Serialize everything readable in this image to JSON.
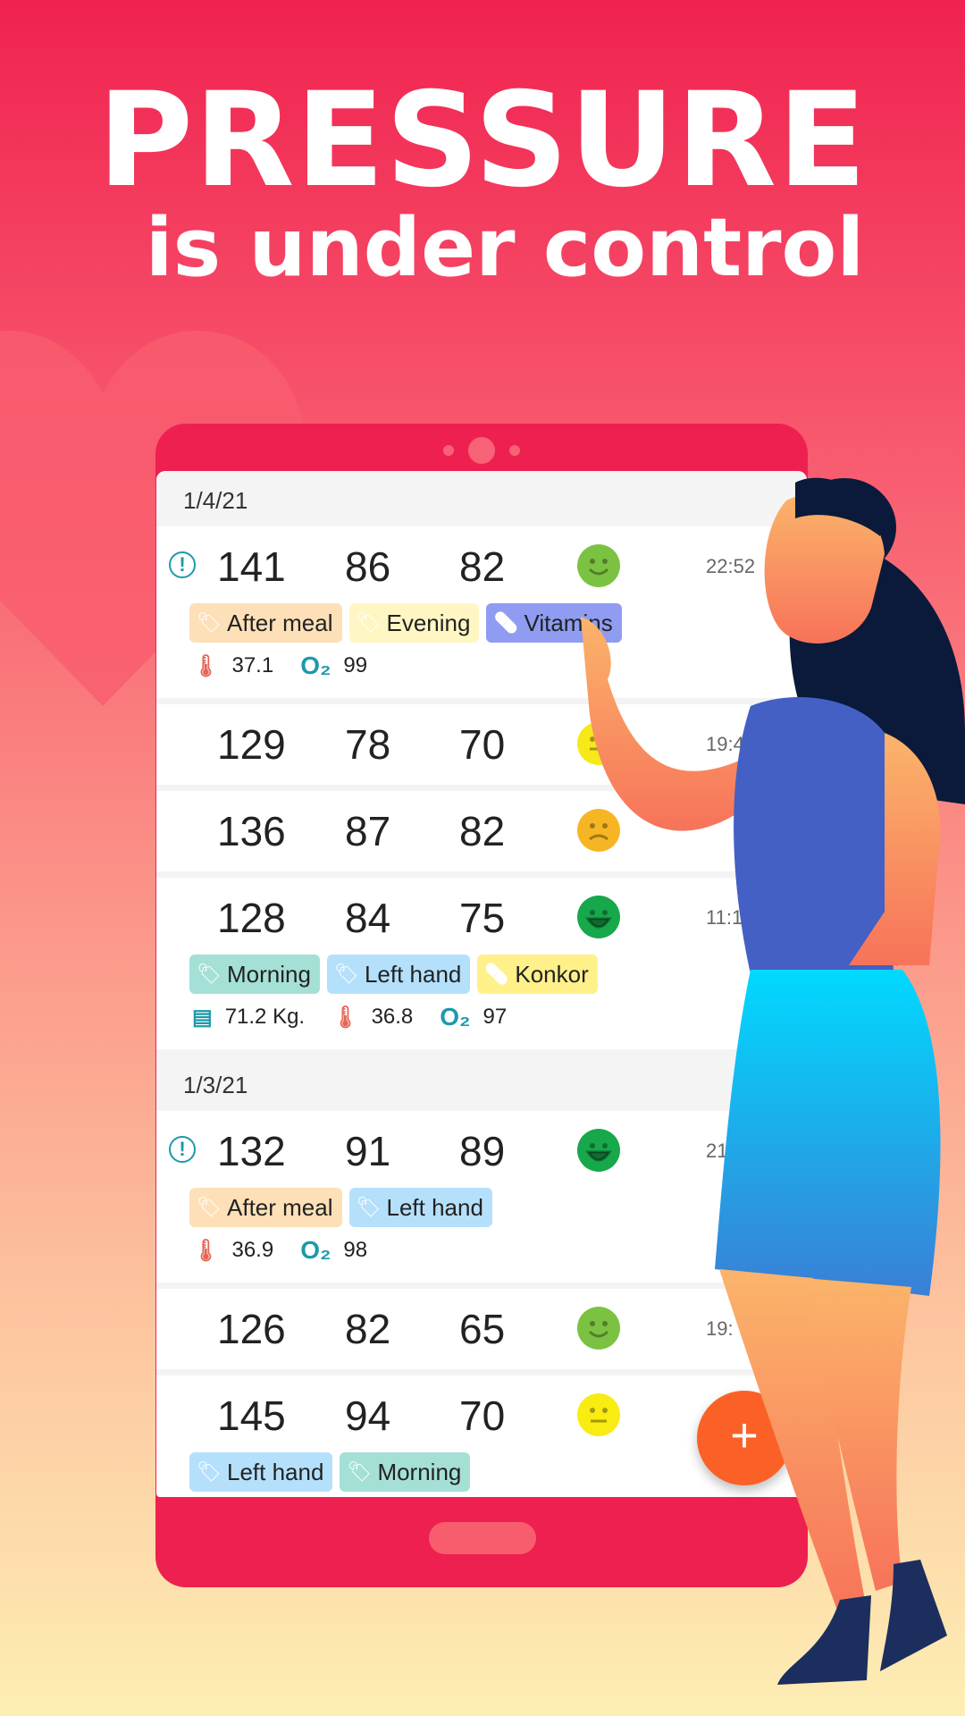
{
  "headline": {
    "title": "PRESSURE",
    "subtitle": "is under control"
  },
  "colors": {
    "brand": "#ee2050",
    "fab": "#fb6126",
    "icon": "#1b9aaa"
  },
  "fab": {
    "label": "+",
    "icon": "plus-icon"
  },
  "groups": [
    {
      "date": "1/4/21",
      "entries": [
        {
          "alert": true,
          "sys": "141",
          "dia": "86",
          "pulse": "82",
          "mood": "smile",
          "time": "22:52",
          "tags": [
            {
              "label": "After meal",
              "type": "tag",
              "color": "#fde0b7"
            },
            {
              "label": "Evening",
              "type": "tag",
              "color": "#fff6c4"
            },
            {
              "label": "Vitamins",
              "type": "pill",
              "color": "#8f9cf2"
            }
          ],
          "metrics": {
            "temp": "37.1",
            "o2": "99"
          }
        },
        {
          "sys": "129",
          "dia": "78",
          "pulse": "70",
          "mood": "yellow",
          "time": "19:43",
          "tags": []
        },
        {
          "sys": "136",
          "dia": "87",
          "pulse": "82",
          "mood": "sad",
          "time": "",
          "tags": []
        },
        {
          "sys": "128",
          "dia": "84",
          "pulse": "75",
          "mood": "laugh",
          "time": "11:10",
          "tags": [
            {
              "label": "Morning",
              "type": "tag",
              "color": "#a4e0d6"
            },
            {
              "label": "Left hand",
              "type": "tag",
              "color": "#b5e0fb"
            },
            {
              "label": "Konkor",
              "type": "pill",
              "color": "#fff08a"
            }
          ],
          "metrics": {
            "weight": "71.2 Kg.",
            "temp": "36.8",
            "o2": "97"
          }
        }
      ]
    },
    {
      "date": "1/3/21",
      "entries": [
        {
          "alert": true,
          "sys": "132",
          "dia": "91",
          "pulse": "89",
          "mood": "laugh",
          "time": "21:2",
          "tags": [
            {
              "label": "After meal",
              "type": "tag",
              "color": "#fde0b7"
            },
            {
              "label": "Left hand",
              "type": "tag",
              "color": "#b5e0fb"
            }
          ],
          "metrics": {
            "temp": "36.9",
            "o2": "98"
          }
        },
        {
          "sys": "126",
          "dia": "82",
          "pulse": "65",
          "mood": "smile",
          "time": "19:",
          "tags": []
        },
        {
          "sys": "145",
          "dia": "94",
          "pulse": "70",
          "mood": "neutral",
          "time": "",
          "tags": [
            {
              "label": "Left hand",
              "type": "tag",
              "color": "#b5e0fb"
            },
            {
              "label": "Morning",
              "type": "tag",
              "color": "#a4e0d6"
            }
          ]
        }
      ]
    }
  ]
}
